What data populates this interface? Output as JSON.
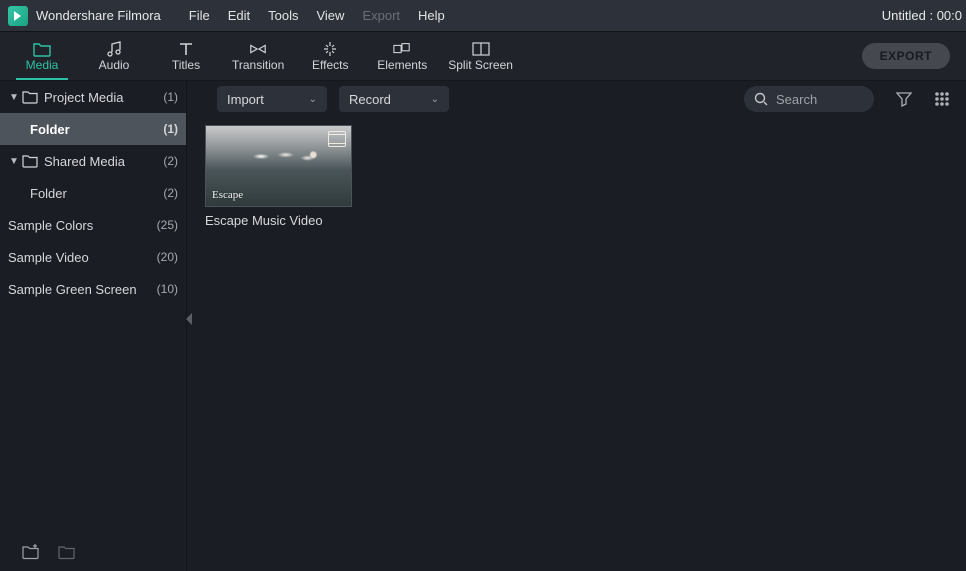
{
  "app": {
    "title": "Wondershare Filmora",
    "project_status": "Untitled : 00:0"
  },
  "menu": {
    "items": [
      "File",
      "Edit",
      "Tools",
      "View",
      "Export",
      "Help"
    ],
    "disabled_index": 4
  },
  "tabs": {
    "items": [
      "Media",
      "Audio",
      "Titles",
      "Transition",
      "Effects",
      "Elements",
      "Split Screen"
    ],
    "active_index": 0,
    "export_label": "EXPORT"
  },
  "sidebar": {
    "tree": [
      {
        "name": "Project Media",
        "count": "(1)",
        "level": 0,
        "has_caret": true,
        "has_icon": true,
        "selected": false
      },
      {
        "name": "Folder",
        "count": "(1)",
        "level": 1,
        "has_caret": false,
        "has_icon": false,
        "selected": true
      },
      {
        "name": "Shared Media",
        "count": "(2)",
        "level": 0,
        "has_caret": true,
        "has_icon": true,
        "selected": false
      },
      {
        "name": "Folder",
        "count": "(2)",
        "level": 1,
        "has_caret": false,
        "has_icon": false,
        "selected": false
      },
      {
        "name": "Sample Colors",
        "count": "(25)",
        "level": 0,
        "has_caret": false,
        "has_icon": false,
        "selected": false
      },
      {
        "name": "Sample Video",
        "count": "(20)",
        "level": 0,
        "has_caret": false,
        "has_icon": false,
        "selected": false
      },
      {
        "name": "Sample Green Screen",
        "count": "(10)",
        "level": 0,
        "has_caret": false,
        "has_icon": false,
        "selected": false
      }
    ]
  },
  "content": {
    "import_label": "Import",
    "record_label": "Record",
    "search_placeholder": "Search",
    "clips": [
      {
        "label": "Escape Music Video",
        "overlay": "Escape"
      }
    ]
  }
}
